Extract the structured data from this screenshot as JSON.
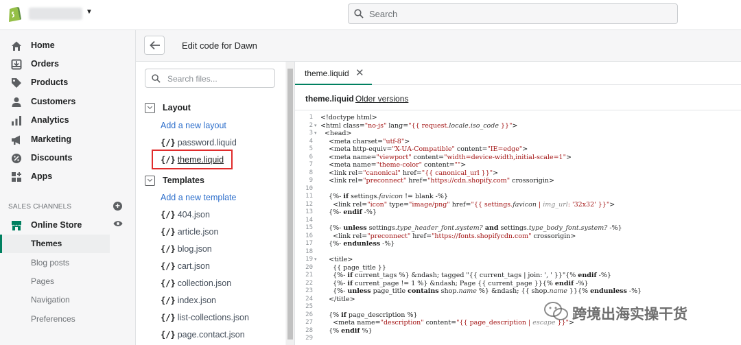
{
  "topbar": {
    "search_placeholder": "Search"
  },
  "nav": {
    "items": [
      {
        "label": "Home",
        "icon": "home-icon"
      },
      {
        "label": "Orders",
        "icon": "orders-icon"
      },
      {
        "label": "Products",
        "icon": "tag-icon"
      },
      {
        "label": "Customers",
        "icon": "person-icon"
      },
      {
        "label": "Analytics",
        "icon": "bar-chart-icon"
      },
      {
        "label": "Marketing",
        "icon": "megaphone-icon"
      },
      {
        "label": "Discounts",
        "icon": "discount-icon"
      },
      {
        "label": "Apps",
        "icon": "apps-icon"
      }
    ],
    "sales_channels_header": "SALES CHANNELS",
    "online_store": "Online Store",
    "sub_items": [
      "Themes",
      "Blog posts",
      "Pages",
      "Navigation",
      "Preferences"
    ],
    "active_sub_item": "Themes",
    "accent_color": "#008060"
  },
  "header": {
    "title": "Edit code for Dawn"
  },
  "files": {
    "search_placeholder": "Search files...",
    "layout": {
      "label": "Layout",
      "add_link": "Add a new layout",
      "items": [
        "password.liquid",
        "theme.liquid"
      ]
    },
    "templates": {
      "label": "Templates",
      "add_link": "Add a new template",
      "items": [
        "404.json",
        "article.json",
        "blog.json",
        "cart.json",
        "collection.json",
        "index.json",
        "list-collections.json",
        "page.contact.json"
      ]
    },
    "brace_glyph": "{/}",
    "selected_file": "theme.liquid"
  },
  "editor": {
    "tab_label": "theme.liquid",
    "tab_close": "✕",
    "file_name": "theme.liquid",
    "older_versions": "Older versions",
    "line_numbers": [
      "1",
      "2",
      "3",
      "4",
      "5",
      "6",
      "7",
      "8",
      "9",
      "10",
      "11",
      "12",
      "13",
      "14",
      "15",
      "16",
      "17",
      "18",
      "19",
      "20",
      "21",
      "22",
      "23",
      "24",
      "25",
      "26",
      "27",
      "28",
      "29"
    ]
  },
  "watermark": {
    "text": "跨境出海实操干货"
  }
}
